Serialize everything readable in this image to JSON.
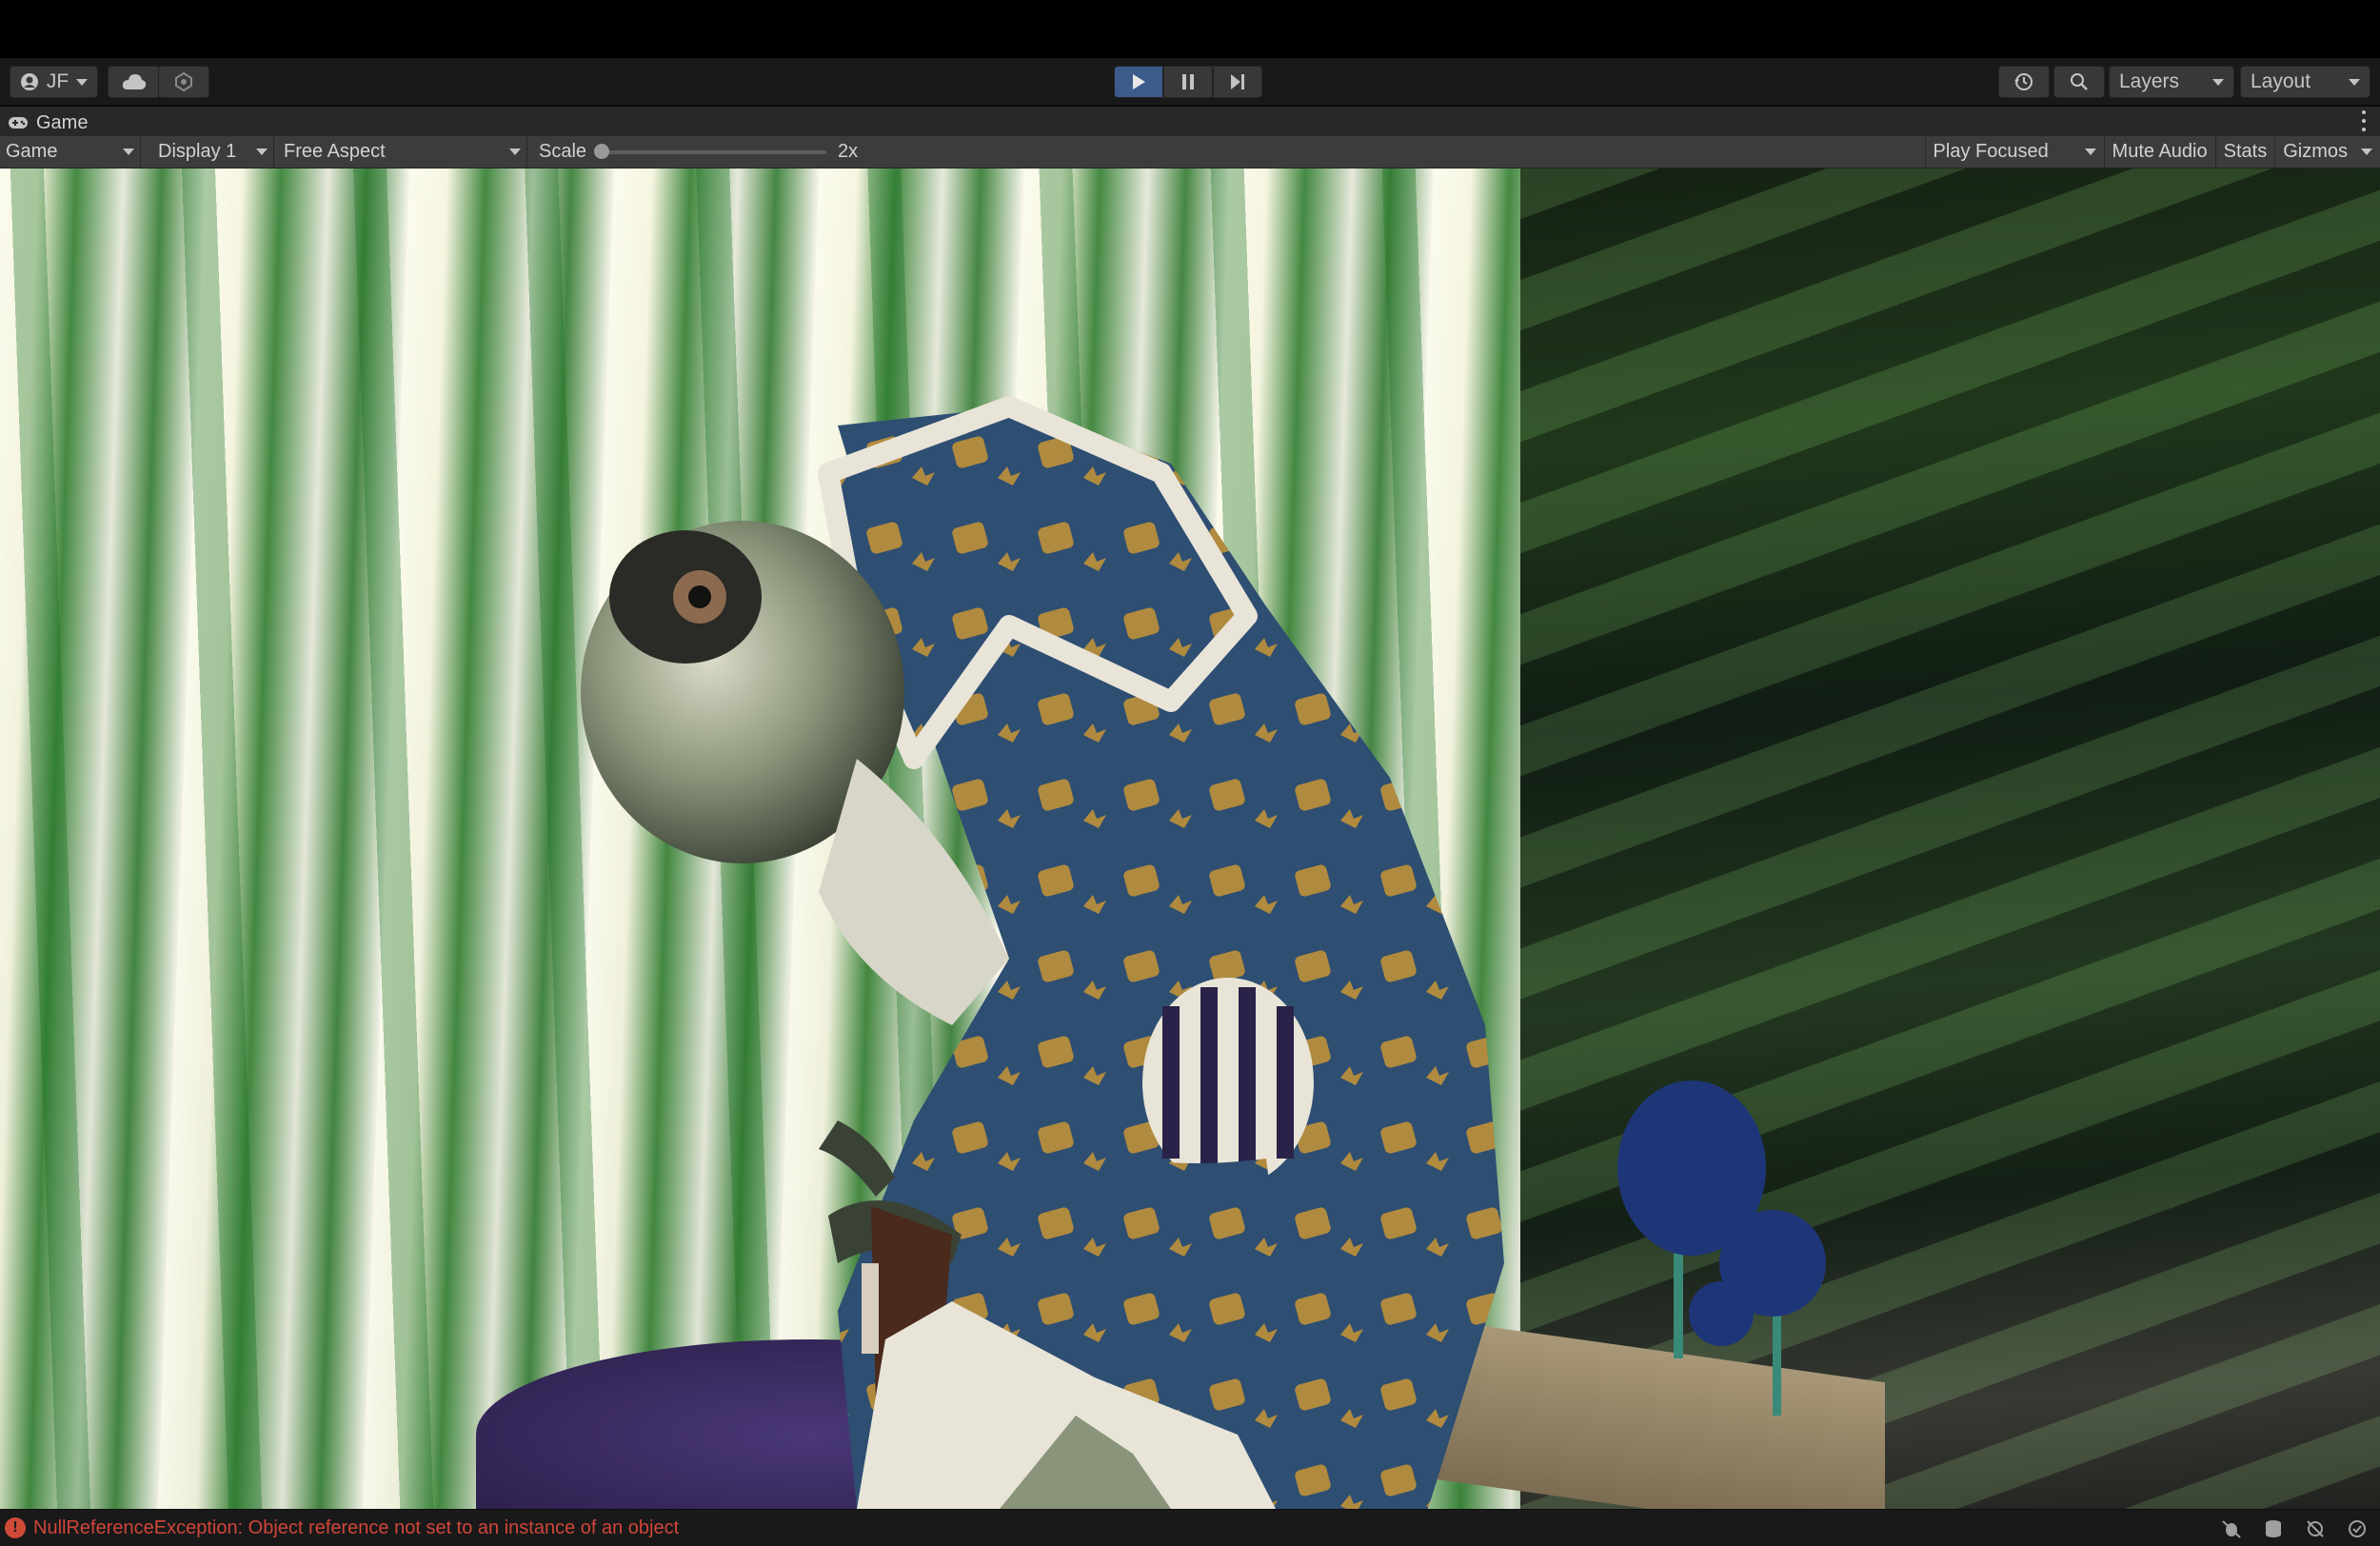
{
  "toolbar": {
    "account_label": "JF",
    "layers_label": "Layers",
    "layout_label": "Layout",
    "play_active": true
  },
  "tab": {
    "title": "Game"
  },
  "gamebar": {
    "view_mode": "Game",
    "display": "Display 1",
    "aspect": "Free Aspect",
    "scale_label": "Scale",
    "scale_value": "2x",
    "play_focused": "Play Focused",
    "mute_audio": "Mute Audio",
    "stats": "Stats",
    "gizmos": "Gizmos"
  },
  "status": {
    "error_message": "NullReferenceException: Object reference not set to an instance of an object",
    "error_color": "#d0463a"
  },
  "colors": {
    "toolbar_bg": "#191919",
    "gamebar_bg": "#3c3c3c",
    "play_active": "#3b5b8a"
  }
}
